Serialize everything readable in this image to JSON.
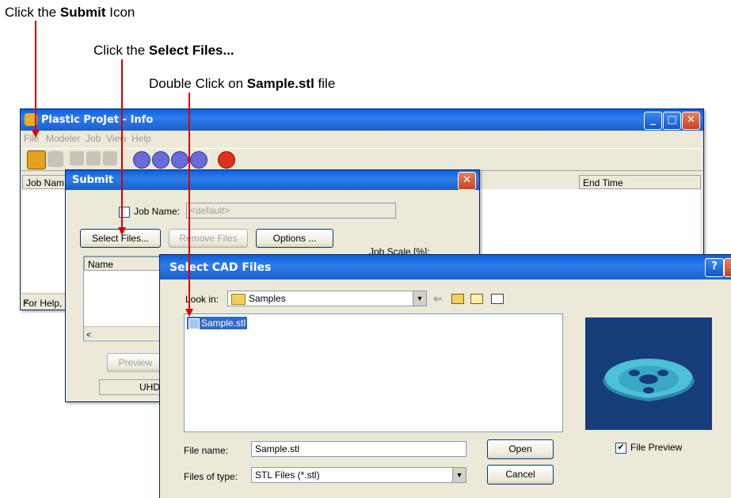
{
  "annotations": {
    "a1_pre": "Click the ",
    "a1_bold": "Submit",
    "a1_post": " Icon",
    "a2_pre": "Click the ",
    "a2_bold": "Select Files...",
    "a3_pre": "Double Click on ",
    "a3_bold": "Sample.stl",
    "a3_post": " file"
  },
  "main_window": {
    "title": "Plastic ProJet - Info",
    "menu": [
      "File",
      "Modeler",
      "Job",
      "View",
      "Help"
    ],
    "col_job_name": "Job Nam",
    "col_end_time": "End Time",
    "status": "For Help,"
  },
  "submit_dialog": {
    "title": "Submit",
    "job_name_label": "Job Name:",
    "job_name_placeholder": "<default>",
    "select_files": "Select Files...",
    "remove_files": "Remove Files",
    "options": "Options ...",
    "job_scale": "Job Scale [%]:",
    "col_name": "Name",
    "preview": "Preview",
    "mode": "UHD"
  },
  "cad_dialog": {
    "title": "Select CAD Files",
    "look_in_label": "Look in:",
    "look_in_value": "Samples",
    "file_item": "Sample.stl",
    "file_name_label": "File name:",
    "file_name_value": "Sample.stl",
    "files_of_type_label": "Files of type:",
    "files_of_type_value": "STL Files  (*.stl)",
    "open": "Open",
    "cancel": "Cancel",
    "file_preview_label": "File Preview",
    "file_preview_checked": "✔",
    "help_btn": "?",
    "close_btn": "✕"
  },
  "colors": {
    "arrow": "#d40000",
    "titlebar": "#1c5fd0",
    "preview_bg": "#163d7a"
  }
}
